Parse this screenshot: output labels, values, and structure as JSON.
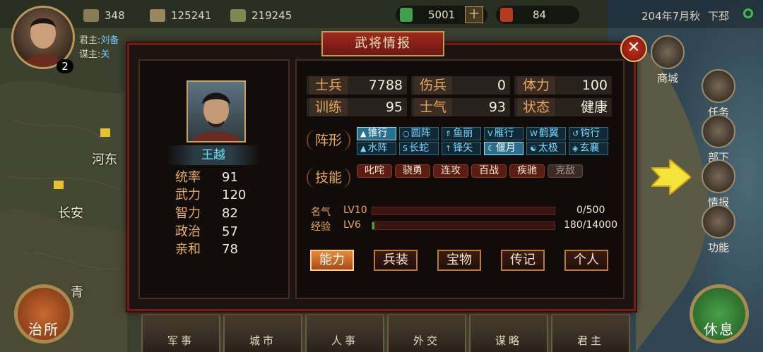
{
  "hud": {
    "resources": [
      {
        "icon": "troops-icon",
        "value": "348"
      },
      {
        "icon": "grain-icon",
        "value": "125241"
      },
      {
        "icon": "wheat-icon",
        "value": "219245"
      }
    ],
    "jade": {
      "icon": "jade-icon",
      "value": "5001",
      "add": "十"
    },
    "token": {
      "icon": "token-icon",
      "value": "84"
    },
    "date": "204年7月秋",
    "city": "下邳",
    "player_level": "2",
    "lord_label": "君主:",
    "lord_name": "刘备",
    "advisor_label": "谋主:",
    "advisor_name": "关"
  },
  "map_labels": [
    "河东",
    "长安",
    "青"
  ],
  "side_menu": [
    "商城",
    "任务",
    "部下",
    "情报",
    "功能"
  ],
  "bottom_tabs": [
    "军事",
    "城市",
    "人事",
    "外交",
    "谋略",
    "君主"
  ],
  "left_round_button": "治所",
  "right_round_button": "休息",
  "dialog": {
    "title": "武将情报",
    "close": "✕",
    "general": {
      "name": "王越",
      "stats": [
        {
          "label": "统率",
          "value": "91"
        },
        {
          "label": "武力",
          "value": "120"
        },
        {
          "label": "智力",
          "value": "82"
        },
        {
          "label": "政治",
          "value": "57"
        },
        {
          "label": "亲和",
          "value": "78"
        }
      ]
    },
    "info_grid": [
      [
        {
          "label": "士兵",
          "value": "7788"
        },
        {
          "label": "伤兵",
          "value": "0"
        },
        {
          "label": "体力",
          "value": "100"
        }
      ],
      [
        {
          "label": "训练",
          "value": "95"
        },
        {
          "label": "士气",
          "value": "93"
        },
        {
          "label": "状态",
          "value": "健康"
        }
      ]
    ],
    "formation_label": "阵形",
    "formations": [
      [
        {
          "glyph": "▲",
          "name": "锥行",
          "selected": true
        },
        {
          "glyph": "○",
          "name": "圆阵",
          "selected": false
        },
        {
          "glyph": "⇑",
          "name": "鱼丽",
          "selected": false
        },
        {
          "glyph": "V",
          "name": "雁行",
          "selected": false
        },
        {
          "glyph": "W",
          "name": "鹤翼",
          "selected": false
        },
        {
          "glyph": "↺",
          "name": "钩行",
          "selected": false
        }
      ],
      [
        {
          "glyph": "▲",
          "name": "水阵",
          "selected": false
        },
        {
          "glyph": "S",
          "name": "长蛇",
          "selected": false
        },
        {
          "glyph": "↑",
          "name": "锋矢",
          "selected": false
        },
        {
          "glyph": "☾",
          "name": "偃月",
          "selected": true
        },
        {
          "glyph": "☯",
          "name": "太极",
          "selected": false
        },
        {
          "glyph": "◈",
          "name": "玄襄",
          "selected": false
        }
      ]
    ],
    "skill_label": "技能",
    "skills": [
      {
        "name": "叱咤",
        "active": true
      },
      {
        "name": "骁勇",
        "active": true
      },
      {
        "name": "连攻",
        "active": true
      },
      {
        "name": "百战",
        "active": true
      },
      {
        "name": "疾驰",
        "active": true
      },
      {
        "name": "克敌",
        "active": false
      }
    ],
    "fame": {
      "label": "名气",
      "level": "LV10",
      "current": 0,
      "max": 500,
      "text": "0/500"
    },
    "exp": {
      "label": "经验",
      "level": "LV6",
      "current": 180,
      "max": 14000,
      "text": "180/14000"
    },
    "tabs": [
      {
        "label": "能力",
        "active": true
      },
      {
        "label": "兵装",
        "active": false
      },
      {
        "label": "宝物",
        "active": false
      },
      {
        "label": "传记",
        "active": false
      },
      {
        "label": "个人",
        "active": false
      }
    ]
  },
  "colors": {
    "accent_orange": "#e9a85e",
    "name_cyan": "#6fe0ff",
    "dialog_border": "#6f1e16",
    "exp_green": "#2bb34a"
  }
}
